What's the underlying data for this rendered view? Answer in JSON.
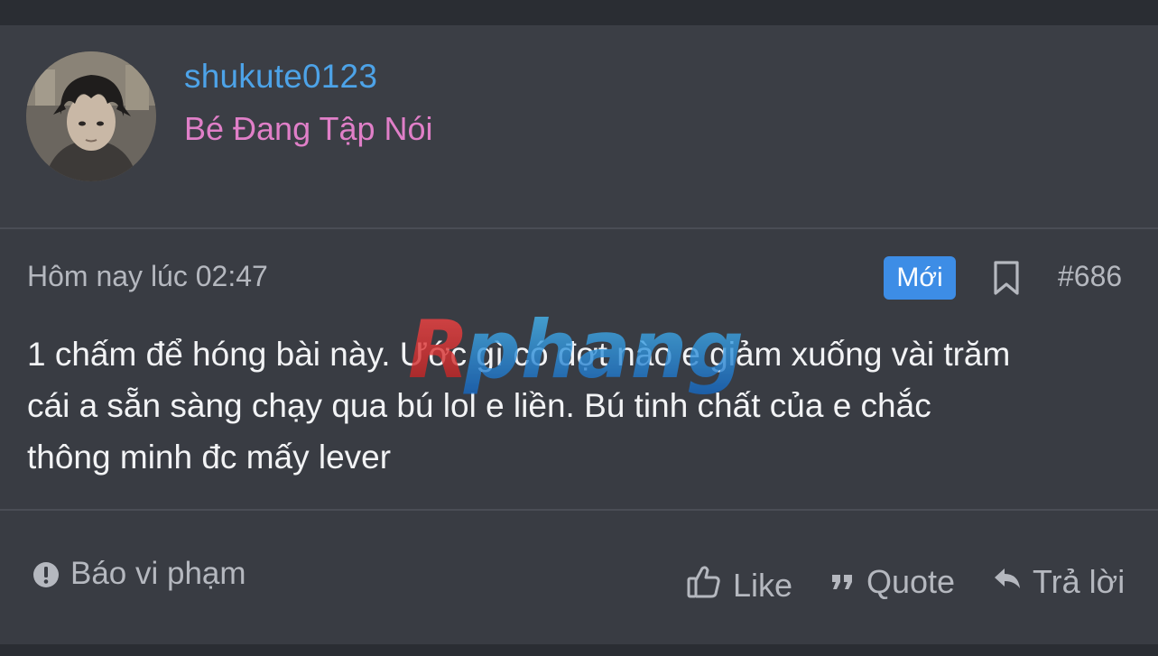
{
  "user": {
    "username": "shukute0123",
    "title": "Bé Đang Tập Nói"
  },
  "post": {
    "timestamp": "Hôm nay lúc 02:47",
    "badge": "Mới",
    "number": "#686",
    "body_lines": [
      "1 chấm để hóng bài này. Ước gì có đợt nào e giảm xuống vài trăm",
      "cái a sẵn sàng chạy qua bú lol e liền. Bú tinh chất của e chắc",
      "thông minh đc mấy lever"
    ]
  },
  "footer": {
    "report_label": "Báo vi phạm",
    "like_label": "Like",
    "quote_label": "Quote",
    "reply_label": "Trả lời"
  },
  "watermark": {
    "text": "Rphang"
  },
  "icons": {
    "report": "exclamation-circle-icon",
    "bookmark": "bookmark-icon",
    "like": "thumbs-up-icon",
    "quote": "quote-icon",
    "reply": "reply-icon"
  },
  "colors": {
    "username": "#4da3e8",
    "user_title": "#e07fc8",
    "badge_bg": "#3d8de6",
    "card_bg": "#393c43",
    "page_bg": "#2a2d33",
    "muted_text": "#b5b8bf",
    "body_text": "#f2f3f5"
  }
}
